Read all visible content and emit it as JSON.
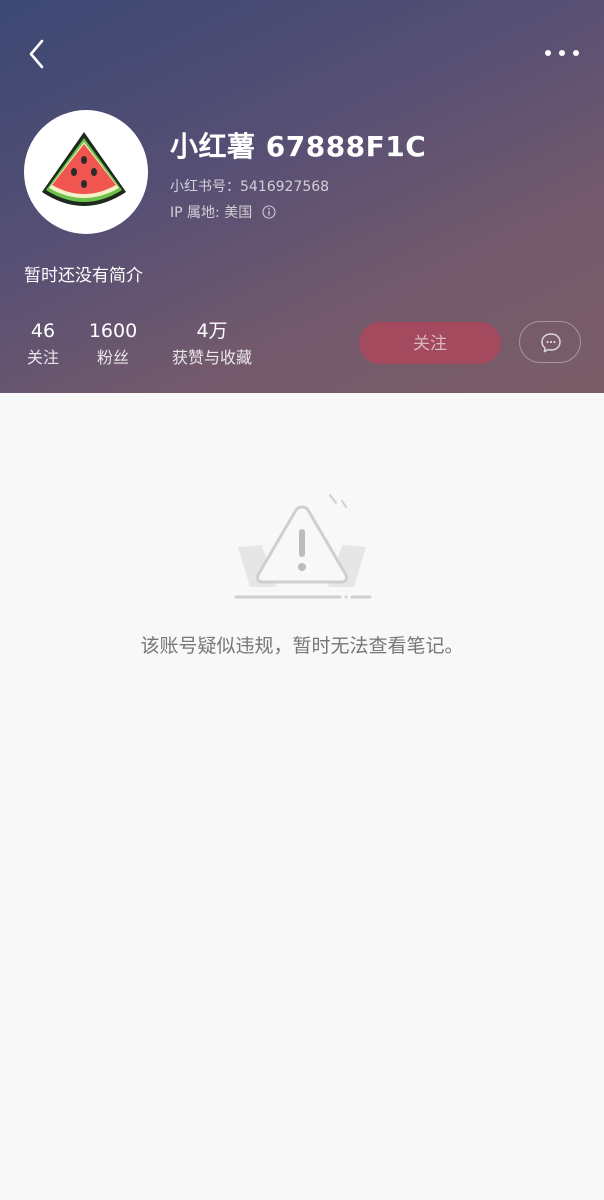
{
  "colors": {
    "header_gradient_start": "#3b4874",
    "header_gradient_end": "#7a5c66",
    "follow_button": "#a44a5e",
    "content_background": "#f8f8f8"
  },
  "nav": {
    "back_icon": "chevron-left-icon",
    "more_icon": "more-horizontal-icon"
  },
  "profile": {
    "avatar_icon": "watermelon-icon",
    "username": "小红薯 67888F1C",
    "id_text": "小红书号：5416927568",
    "ip_text": "IP 属地: 美国",
    "bio": "暂时还没有简介"
  },
  "stats": {
    "following": {
      "value": "46",
      "label": "关注"
    },
    "followers": {
      "value": "1600",
      "label": "粉丝"
    },
    "likes": {
      "value": "4万",
      "label": "获赞与收藏"
    }
  },
  "actions": {
    "follow_label": "关注",
    "message_icon": "chat-bubble-icon"
  },
  "notice": {
    "icon": "warning-triangle-icon",
    "message": "该账号疑似违规，暂时无法查看笔记。"
  }
}
